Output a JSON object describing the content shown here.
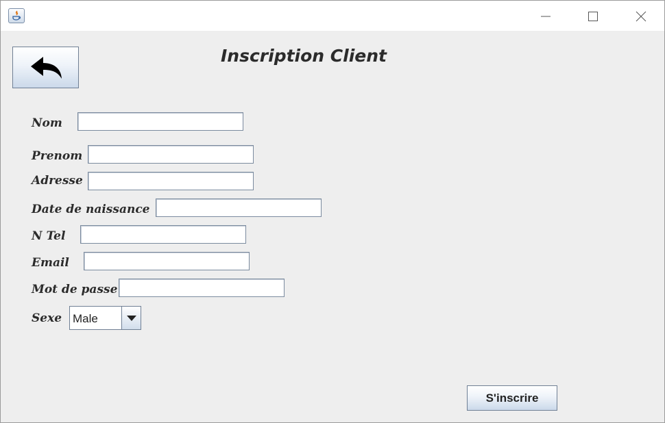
{
  "window": {
    "controls": {
      "minimize": "minimize-icon",
      "maximize": "maximize-icon",
      "close": "close-icon"
    },
    "icon": "java-app-icon"
  },
  "back_button": {
    "icon": "back-arrow-icon"
  },
  "title": "Inscription Client",
  "form": {
    "nom": {
      "label": "Nom",
      "value": ""
    },
    "prenom": {
      "label": "Prenom",
      "value": ""
    },
    "adresse": {
      "label": "Adresse",
      "value": ""
    },
    "date_naissance": {
      "label": "Date de naissance",
      "value": ""
    },
    "tel": {
      "label": "N Tel",
      "value": ""
    },
    "email": {
      "label": "Email",
      "value": ""
    },
    "mot_de_passe": {
      "label": "Mot de passe",
      "value": ""
    },
    "sexe": {
      "label": "Sexe",
      "selected": "Male"
    }
  },
  "submit_label": "S'inscrire"
}
